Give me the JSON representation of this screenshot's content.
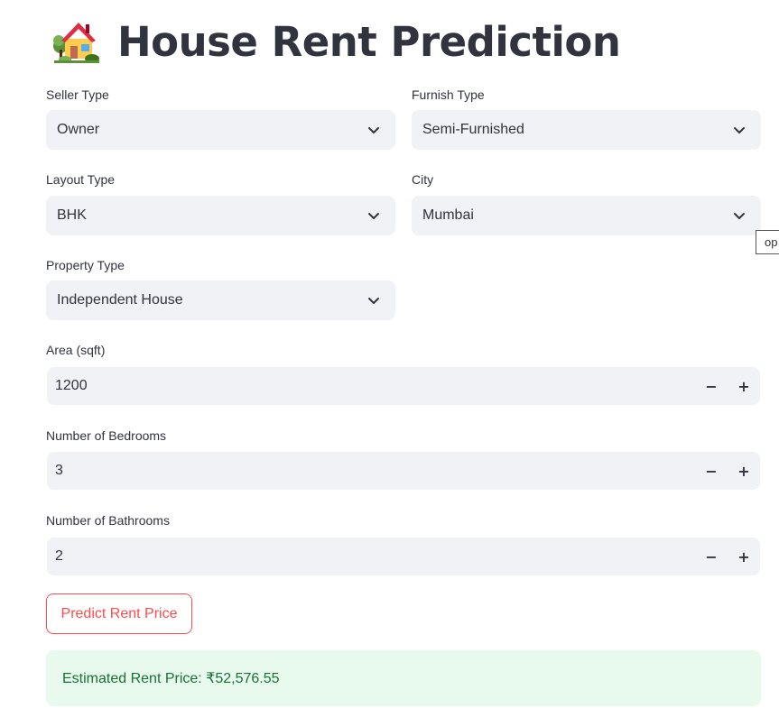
{
  "header": {
    "title": "House Rent Prediction",
    "icon": "house-with-garden-icon"
  },
  "form": {
    "seller_type": {
      "label": "Seller Type",
      "value": "Owner"
    },
    "furnish_type": {
      "label": "Furnish Type",
      "value": "Semi-Furnished"
    },
    "layout_type": {
      "label": "Layout Type",
      "value": "BHK"
    },
    "city": {
      "label": "City",
      "value": "Mumbai"
    },
    "property_type": {
      "label": "Property Type",
      "value": "Independent House"
    },
    "area": {
      "label": "Area (sqft)",
      "value": "1200"
    },
    "bedrooms": {
      "label": "Number of Bedrooms",
      "value": "3"
    },
    "bathrooms": {
      "label": "Number of Bathrooms",
      "value": "2"
    },
    "stepper": {
      "minus": "−",
      "plus": "+"
    }
  },
  "actions": {
    "predict_label": "Predict Rent Price"
  },
  "result": {
    "text": "Estimated Rent Price: ₹52,576.55"
  },
  "tooltip": {
    "text": "op"
  },
  "colors": {
    "accent": "#ff4b4b",
    "input_bg": "#f0f2f6",
    "success_bg": "#e8f9ee",
    "success_text": "#177233",
    "text": "#31333f"
  }
}
